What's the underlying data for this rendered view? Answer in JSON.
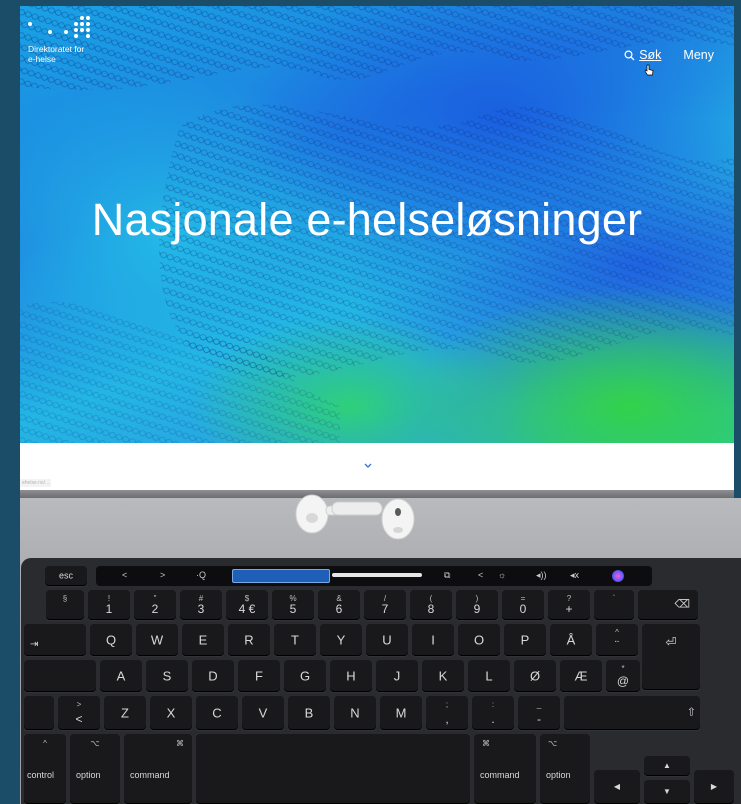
{
  "site": {
    "org_line1": "Direktoratet for",
    "org_line2": "e-helse",
    "nav_search": "Søk",
    "nav_menu": "Meny",
    "hero_title": "Nasjonale e-helseløsninger",
    "url_hint": "ehelse.no/..."
  },
  "keyboard": {
    "esc": "esc",
    "number_row": [
      {
        "top": "§",
        "main": "1",
        "sup": "!"
      },
      {
        "top": "\"",
        "main": "2"
      },
      {
        "top": "#",
        "main": "3"
      },
      {
        "top": "$",
        "main": "4 €"
      },
      {
        "top": "%",
        "main": "5"
      },
      {
        "top": "&",
        "main": "6"
      },
      {
        "top": "/",
        "main": "7"
      },
      {
        "top": "(",
        "main": "8"
      },
      {
        "top": ")",
        "main": "9"
      },
      {
        "top": "=",
        "main": "0"
      },
      {
        "top": "?",
        "main": "+"
      }
    ],
    "row_q": [
      "Q",
      "W",
      "E",
      "R",
      "T",
      "Y",
      "U",
      "I",
      "O",
      "P",
      "Å"
    ],
    "row_a": [
      "A",
      "S",
      "D",
      "F",
      "G",
      "H",
      "J",
      "K",
      "L",
      "Ø",
      "Æ"
    ],
    "row_z": [
      "Z",
      "X",
      "C",
      "V",
      "B",
      "N",
      "M"
    ],
    "row_z_labels": {
      "less": "<",
      "greater": ">"
    },
    "bottom_row": {
      "control": "control",
      "option_left": "option",
      "command_left": "command",
      "command_right": "command",
      "option_right": "option",
      "option_symbol": "⌥",
      "command_symbol": "⌘"
    }
  }
}
